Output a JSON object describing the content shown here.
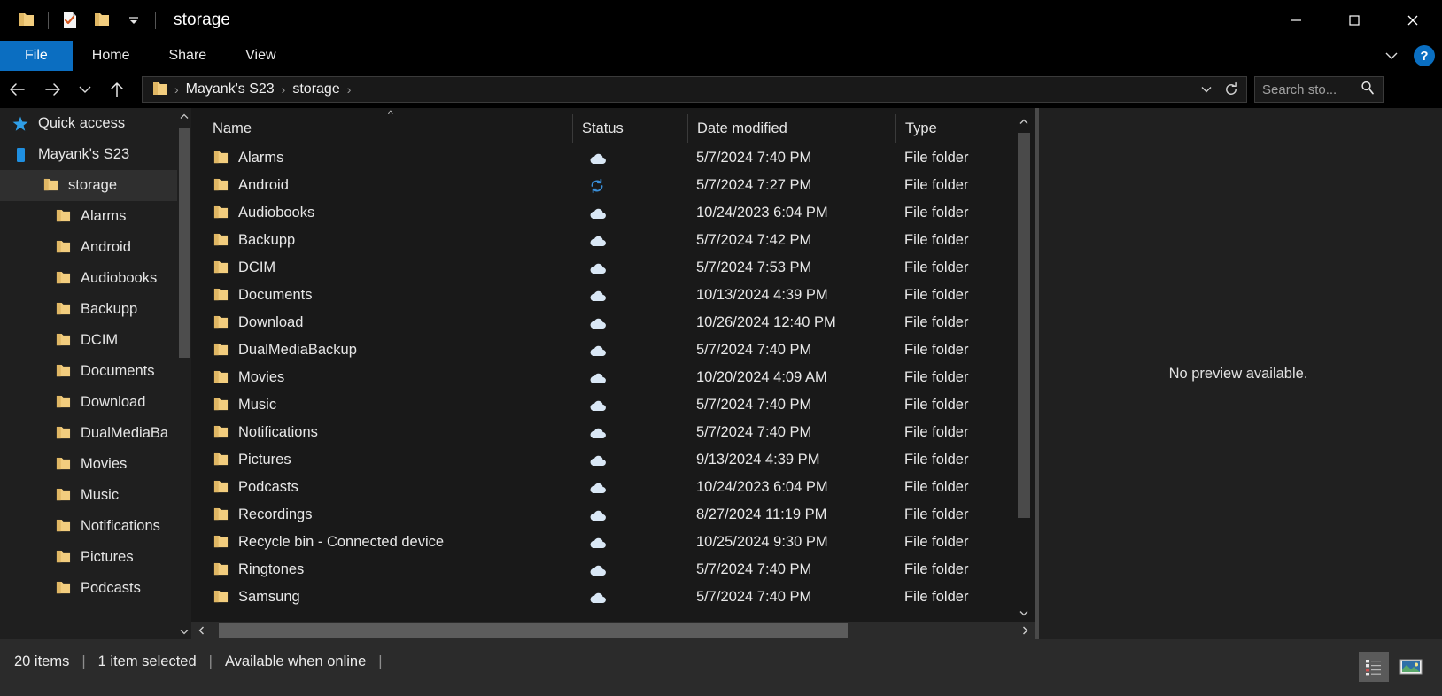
{
  "window": {
    "title": "storage",
    "quick_access_icons": [
      "folder-icon",
      "properties-icon",
      "new-folder-icon",
      "customize-qat-chevron-icon"
    ],
    "controls": {
      "minimize": "minimize-icon",
      "maximize": "maximize-icon",
      "close": "close-icon"
    }
  },
  "ribbon": {
    "tabs": [
      {
        "label": "File",
        "active": true
      },
      {
        "label": "Home",
        "active": false
      },
      {
        "label": "Share",
        "active": false
      },
      {
        "label": "View",
        "active": false
      }
    ],
    "expand_icon": "chevron-down-icon",
    "help_label": "?"
  },
  "nav": {
    "back_icon": "arrow-left-icon",
    "forward_icon": "arrow-right-icon",
    "recent_icon": "chevron-down-icon",
    "up_icon": "arrow-up-icon",
    "breadcrumb": [
      "Mayank's S23",
      "storage"
    ],
    "breadcrumb_separator": "›",
    "history_icon": "chevron-down-icon",
    "refresh_icon": "refresh-icon"
  },
  "search": {
    "placeholder": "Search sto...",
    "icon": "search-icon"
  },
  "sidebar": {
    "items": [
      {
        "label": "Quick access",
        "icon": "star-icon",
        "level": 0,
        "selected": false
      },
      {
        "label": "Mayank's S23",
        "icon": "phone-icon",
        "level": 0,
        "selected": false
      },
      {
        "label": "storage",
        "icon": "folder-icon",
        "level": 1,
        "selected": true
      },
      {
        "label": "Alarms",
        "icon": "folder-icon",
        "level": 2,
        "selected": false
      },
      {
        "label": "Android",
        "icon": "folder-icon",
        "level": 2,
        "selected": false
      },
      {
        "label": "Audiobooks",
        "icon": "folder-icon",
        "level": 2,
        "selected": false
      },
      {
        "label": "Backupp",
        "icon": "folder-icon",
        "level": 2,
        "selected": false
      },
      {
        "label": "DCIM",
        "icon": "folder-icon",
        "level": 2,
        "selected": false
      },
      {
        "label": "Documents",
        "icon": "folder-icon",
        "level": 2,
        "selected": false
      },
      {
        "label": "Download",
        "icon": "folder-icon",
        "level": 2,
        "selected": false
      },
      {
        "label": "DualMediaBa",
        "icon": "folder-icon",
        "level": 2,
        "selected": false
      },
      {
        "label": "Movies",
        "icon": "folder-icon",
        "level": 2,
        "selected": false
      },
      {
        "label": "Music",
        "icon": "folder-icon",
        "level": 2,
        "selected": false
      },
      {
        "label": "Notifications",
        "icon": "folder-icon",
        "level": 2,
        "selected": false
      },
      {
        "label": "Pictures",
        "icon": "folder-icon",
        "level": 2,
        "selected": false
      },
      {
        "label": "Podcasts",
        "icon": "folder-icon",
        "level": 2,
        "selected": false
      }
    ]
  },
  "filelist": {
    "columns": [
      "Name",
      "Status",
      "Date modified",
      "Type"
    ],
    "sort_indicator": "ascending",
    "rows": [
      {
        "name": "Alarms",
        "status": "cloud-only-icon",
        "date": "5/7/2024 7:40 PM",
        "type": "File folder"
      },
      {
        "name": "Android",
        "status": "syncing-icon",
        "date": "5/7/2024 7:27 PM",
        "type": "File folder"
      },
      {
        "name": "Audiobooks",
        "status": "cloud-only-icon",
        "date": "10/24/2023 6:04 PM",
        "type": "File folder"
      },
      {
        "name": "Backupp",
        "status": "cloud-only-icon",
        "date": "5/7/2024 7:42 PM",
        "type": "File folder"
      },
      {
        "name": "DCIM",
        "status": "cloud-only-icon",
        "date": "5/7/2024 7:53 PM",
        "type": "File folder"
      },
      {
        "name": "Documents",
        "status": "cloud-only-icon",
        "date": "10/13/2024 4:39 PM",
        "type": "File folder"
      },
      {
        "name": "Download",
        "status": "cloud-only-icon",
        "date": "10/26/2024 12:40 PM",
        "type": "File folder"
      },
      {
        "name": "DualMediaBackup",
        "status": "cloud-only-icon",
        "date": "5/7/2024 7:40 PM",
        "type": "File folder"
      },
      {
        "name": "Movies",
        "status": "cloud-only-icon",
        "date": "10/20/2024 4:09 AM",
        "type": "File folder"
      },
      {
        "name": "Music",
        "status": "cloud-only-icon",
        "date": "5/7/2024 7:40 PM",
        "type": "File folder"
      },
      {
        "name": "Notifications",
        "status": "cloud-only-icon",
        "date": "5/7/2024 7:40 PM",
        "type": "File folder"
      },
      {
        "name": "Pictures",
        "status": "cloud-only-icon",
        "date": "9/13/2024 4:39 PM",
        "type": "File folder"
      },
      {
        "name": "Podcasts",
        "status": "cloud-only-icon",
        "date": "10/24/2023 6:04 PM",
        "type": "File folder"
      },
      {
        "name": "Recordings",
        "status": "cloud-only-icon",
        "date": "8/27/2024 11:19 PM",
        "type": "File folder"
      },
      {
        "name": "Recycle bin - Connected device",
        "status": "cloud-only-icon",
        "date": "10/25/2024 9:30 PM",
        "type": "File folder"
      },
      {
        "name": "Ringtones",
        "status": "cloud-only-icon",
        "date": "5/7/2024 7:40 PM",
        "type": "File folder"
      },
      {
        "name": "Samsung",
        "status": "cloud-only-icon",
        "date": "5/7/2024 7:40 PM",
        "type": "File folder"
      }
    ]
  },
  "preview": {
    "message": "No preview available."
  },
  "statusbar": {
    "item_count": "20 items",
    "selection": "1 item selected",
    "availability": "Available when online",
    "divider": "|",
    "views": [
      {
        "name": "details-view",
        "active": true
      },
      {
        "name": "large-icons-view",
        "active": false
      }
    ]
  },
  "colors": {
    "accent": "#0b6ec1",
    "folder": "#f2cd7e",
    "cloud": "#d9e7f5",
    "sync": "#3a8fd9",
    "window_bg": "#000000",
    "pane_bg": "#191919",
    "sidebar_bg": "#1f1f1f"
  }
}
